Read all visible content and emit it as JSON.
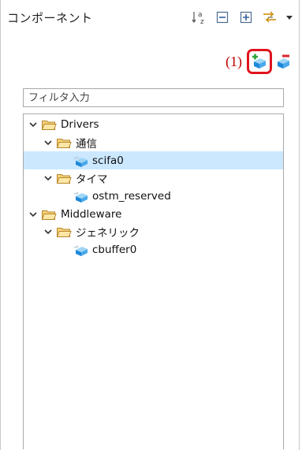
{
  "header": {
    "title": "コンポーネント",
    "tools": [
      {
        "icon": "sort-alphabetical-icon"
      },
      {
        "icon": "collapse-all-icon"
      },
      {
        "icon": "expand-all-icon"
      },
      {
        "icon": "filter-arrows-icon"
      },
      {
        "icon": "view-menu-dropdown-icon"
      }
    ]
  },
  "actions": {
    "step_label": "(1)",
    "add_icon": "add-component-icon",
    "remove_icon": "remove-component-icon",
    "highlight_color": "#e0141e"
  },
  "filter": {
    "placeholder": "フィルタ入力",
    "value": ""
  },
  "tree": {
    "items": [
      {
        "label": "Drivers",
        "type": "folder",
        "expanded": true
      },
      {
        "label": "通信",
        "type": "folder",
        "expanded": true
      },
      {
        "label": "scifa0",
        "type": "component",
        "selected": true
      },
      {
        "label": "タイマ",
        "type": "folder",
        "expanded": true
      },
      {
        "label": "ostm_reserved",
        "type": "component"
      },
      {
        "label": "Middleware",
        "type": "folder",
        "expanded": true
      },
      {
        "label": "ジェネリック",
        "type": "folder",
        "expanded": true
      },
      {
        "label": "cbuffer0",
        "type": "component"
      }
    ],
    "selection_color": "#cce8ff"
  }
}
